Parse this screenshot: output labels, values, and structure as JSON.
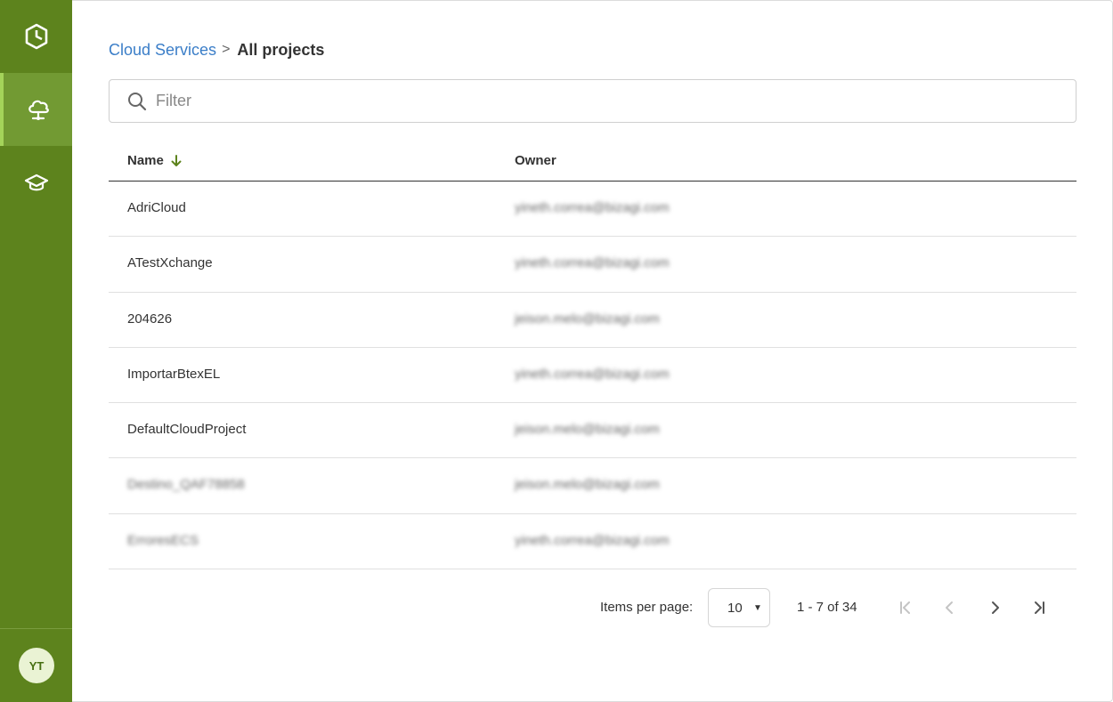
{
  "sidebar": {
    "items": [
      {
        "name": "logo",
        "icon": "hexagon-logo-icon"
      },
      {
        "name": "cloud-services",
        "icon": "cloud-network-icon",
        "active": true
      },
      {
        "name": "learning",
        "icon": "graduation-cap-icon"
      }
    ],
    "avatar_initials": "YT"
  },
  "breadcrumb": {
    "parent": "Cloud Services",
    "separator": ">",
    "current": "All projects"
  },
  "filter": {
    "placeholder": "Filter",
    "value": ""
  },
  "table": {
    "columns": [
      "Name",
      "Owner"
    ],
    "sort": {
      "column": "Name",
      "direction": "descending"
    },
    "rows": [
      {
        "name": "AdriCloud",
        "owner": "yineth.correa@bizagi.com",
        "name_blurred": false
      },
      {
        "name": "ATestXchange",
        "owner": "yineth.correa@bizagi.com",
        "name_blurred": false
      },
      {
        "name": "204626",
        "owner": "jeison.melo@bizagi.com",
        "name_blurred": false
      },
      {
        "name": "ImportarBtexEL",
        "owner": "yineth.correa@bizagi.com",
        "name_blurred": false
      },
      {
        "name": "DefaultCloudProject",
        "owner": "jeison.melo@bizagi.com",
        "name_blurred": false
      },
      {
        "name": "Destino_QAF78858",
        "owner": "jeison.melo@bizagi.com",
        "name_blurred": true
      },
      {
        "name": "ErroresECS",
        "owner": "yineth.correa@bizagi.com",
        "name_blurred": true
      }
    ]
  },
  "paginator": {
    "items_per_page_label": "Items per page:",
    "items_per_page": "10",
    "range_label": "1 - 7 of 34"
  },
  "colors": {
    "sidebar": "#5d831d",
    "sidebar_active": "#729a33",
    "accent": "#3b7ec8",
    "sort_arrow": "#5d831d"
  }
}
